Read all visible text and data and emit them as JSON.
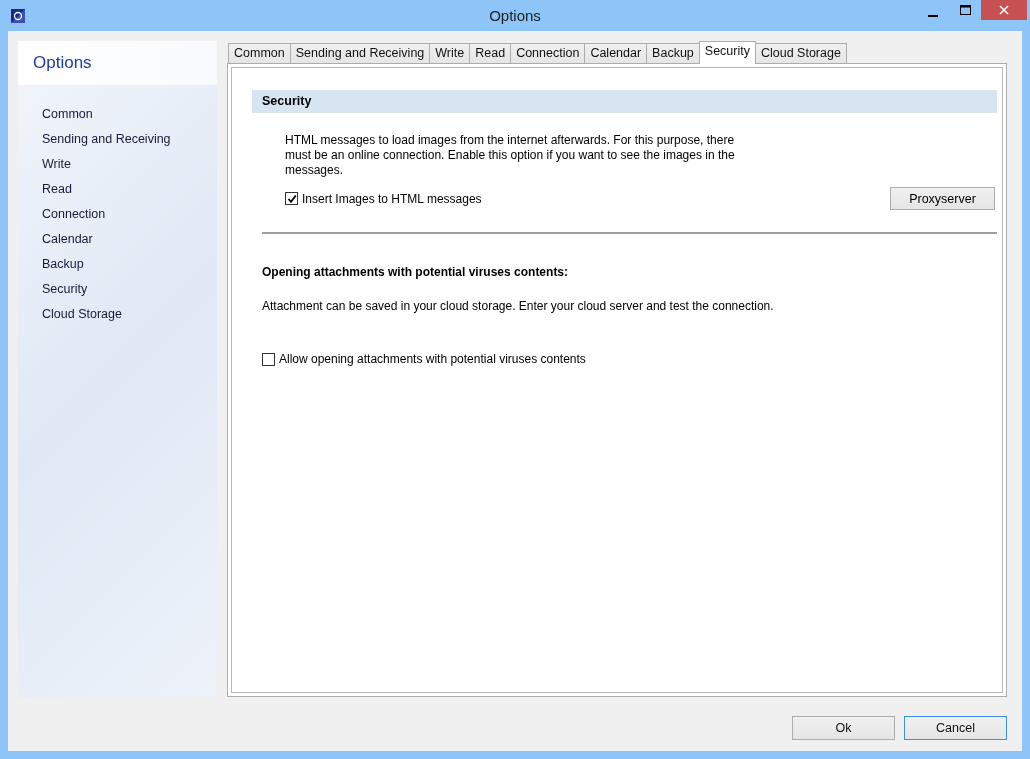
{
  "window": {
    "title": "Options"
  },
  "sidebar": {
    "title": "Options",
    "items": [
      {
        "label": "Common"
      },
      {
        "label": "Sending and Receiving"
      },
      {
        "label": "Write"
      },
      {
        "label": "Read"
      },
      {
        "label": "Connection"
      },
      {
        "label": "Calendar"
      },
      {
        "label": "Backup"
      },
      {
        "label": "Security"
      },
      {
        "label": "Cloud Storage"
      }
    ]
  },
  "tabs": [
    {
      "label": "Common",
      "selected": false
    },
    {
      "label": "Sending and Receiving",
      "selected": false
    },
    {
      "label": "Write",
      "selected": false
    },
    {
      "label": "Read",
      "selected": false
    },
    {
      "label": "Connection",
      "selected": false
    },
    {
      "label": "Calendar",
      "selected": false
    },
    {
      "label": "Backup",
      "selected": false
    },
    {
      "label": "Security",
      "selected": true
    },
    {
      "label": "Cloud Storage",
      "selected": false
    }
  ],
  "section": {
    "title": "Security",
    "description": "HTML messages to load images from the internet afterwards. For this purpose, there must be an online connection. Enable this option if you want to see the images in the messages.",
    "insert_images": {
      "label": "Insert Images to HTML messages",
      "checked": true
    },
    "proxy_button": "Proxyserver"
  },
  "attachments": {
    "heading": "Opening attachments with potential viruses contents:",
    "description": "Attachment can be saved in your cloud storage. Enter your cloud server and test the connection.",
    "allow": {
      "label": "Allow opening attachments with potential viruses contents",
      "checked": false
    }
  },
  "buttons": [
    {
      "label": "Ok",
      "default": false
    },
    {
      "label": "Cancel",
      "default": true
    }
  ]
}
